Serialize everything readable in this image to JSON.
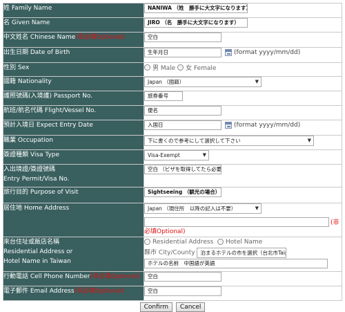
{
  "form": {
    "surname": {
      "label": "姓 Family Name",
      "value": "NANIWA （姓　勝手に大文字になります）"
    },
    "given": {
      "label": "名 Given Name",
      "value": "JIRO （名　勝手に大文字になります）"
    },
    "chinese": {
      "label": "中文姓名 Chinese Name",
      "optional": "(非必填Optional)",
      "value": "空白"
    },
    "dob": {
      "label": "出生日期 Date of Birth",
      "value": "生年月日",
      "hint": "(format yyyy/mm/dd)"
    },
    "sex": {
      "label": "性別 Sex",
      "male": "男 Male",
      "female": "女 Female"
    },
    "nationality": {
      "label": "國籍 Nationality",
      "value": "Japan （國籍）"
    },
    "passport": {
      "label": "護照號碼(入境護) Passport No.",
      "value": "旅券番号"
    },
    "flight": {
      "label": "航班/航名代碼 Flight/Vessel No.",
      "value": "便名"
    },
    "entry_date": {
      "label": "預計入境日 Expect Entry Date",
      "value": "入国日",
      "hint": "(format yyyy/mm/dd)"
    },
    "occupation": {
      "label": "職業 Occupation",
      "value": "下に書くので参考にして選択して下さい"
    },
    "visa_type": {
      "label": "簽證種類 Visa Type",
      "value": "Visa-Exempt"
    },
    "permit": {
      "label1": "入出境證/簽證號碼",
      "label2": "Entry Permit/Visa No.",
      "value": "空白 （ビザを取得してたら必要）"
    },
    "purpose": {
      "label": "旅行目的 Purpose of Visit",
      "value": "Sightseeing （観光の場合）"
    },
    "home": {
      "label": "居住地 Home Address",
      "select": "Japan （現住所　以降の記入は不要）",
      "required_suffix": "(非",
      "required_line": "必填Optional)"
    },
    "residence": {
      "label1": "來台住址或飯店名稱",
      "label2": "Residential Address or",
      "label3": "Hotel Name in Taiwan",
      "opt_res": "Residential Address",
      "opt_hotel": "Hotel Name",
      "city_prefix": "縣市 City/County",
      "city_value": "泊まるホテルの市を選択（台北市Taipei City）",
      "hotel_value": "ホテルの名前　中国語が英語"
    },
    "phone": {
      "label": "行動電話 Cell Phone Number",
      "optional": "(非必填Optional)",
      "value": "空白"
    },
    "email": {
      "label": "電子郵件 Email Address",
      "optional": "(非必填Optional)",
      "value": "空白"
    }
  },
  "buttons": {
    "confirm": "Confirm",
    "cancel": "Cancel"
  }
}
